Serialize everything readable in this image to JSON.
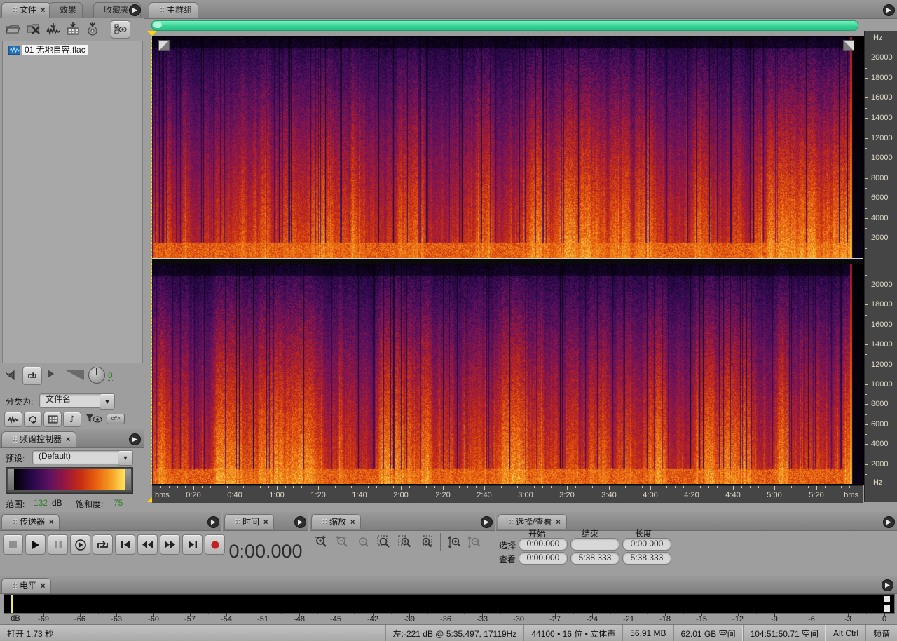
{
  "left_tabs": {
    "files": "文件",
    "effects": "效果",
    "favorites": "收藏夹"
  },
  "files_panel": {
    "file_item": {
      "name": "01 无地自容.flac"
    },
    "preview_volume": "0",
    "sort_label": "分类为:",
    "sort_value": "文件名"
  },
  "spectral_controls": {
    "title": "频谱控制器",
    "preset_label": "预设:",
    "preset_value": "(Default)",
    "range_label": "范围:",
    "range_value": "132",
    "range_unit": "dB",
    "saturation_label": "饱和度:",
    "saturation_value": "75"
  },
  "main_group": {
    "tab": "主群组"
  },
  "transport": {
    "title": "传送器"
  },
  "time_panel": {
    "title": "时间",
    "value": "0:00.000"
  },
  "zoom_panel": {
    "title": "缩放"
  },
  "sel_view": {
    "title": "选择/查看",
    "columns": [
      "开始",
      "结束",
      "长度"
    ],
    "row_labels": [
      "选择",
      "查看"
    ],
    "selection": [
      "0:00.000",
      "",
      "0:00.000"
    ],
    "view": [
      "0:00.000",
      "5:38.333",
      "5:38.333"
    ]
  },
  "levels": {
    "title": "电平",
    "unit_label": "dB",
    "db_ticks": [
      -69,
      -66,
      -63,
      -60,
      -57,
      -54,
      -51,
      -48,
      -45,
      -42,
      -39,
      -36,
      -33,
      -30,
      -27,
      -24,
      -21,
      -18,
      -15,
      -12,
      -9,
      -6,
      -3,
      0
    ]
  },
  "status_bar": {
    "open_time": "打开 1.73 秒",
    "cursor_info": "左:-221 dB @  5:35.497, 17119Hz",
    "format": "44100 • 16 位 • 立体声",
    "file_size": "56.91 MB",
    "disk_free": "62.01 GB 空间",
    "time_free": "104:51:50.71 空间",
    "keys": "Alt Ctrl",
    "view_mode": "频谱"
  },
  "icons": [
    "open-file-icon",
    "close-file-icon",
    "insert-multitrack-icon",
    "insert-video-icon",
    "insert-cd-icon",
    "options-icon",
    "autoplay-speaker-icon",
    "loop-preview-icon",
    "preview-play-icon",
    "volume-meter-icon",
    "volume-knob-icon",
    "filter-waveform-icon",
    "filter-loop-icon",
    "filter-video-icon",
    "filter-midi-icon",
    "filter-funnel-icon",
    "cda-icon",
    "stop-icon",
    "play-icon",
    "pause-icon",
    "play-from-cursor-icon",
    "loop-play-icon",
    "go-start-icon",
    "rewind-icon",
    "fast-forward-icon",
    "go-end-icon",
    "record-icon",
    "zoom-in-h-icon",
    "zoom-out-h-icon",
    "zoom-out-full-icon",
    "zoom-selection-icon",
    "zoom-sel-left-icon",
    "zoom-sel-right-icon",
    "zoom-in-v-icon",
    "zoom-out-v-icon",
    "panel-menu-icon",
    "dropdown-arrow-icon",
    "playhead-marker-icon",
    "fade-handle-icon"
  ],
  "chart_data": {
    "type": "heatmap",
    "subtype": "stereo-audio-spectrogram",
    "title": "01 无地自容.flac — spectral frequency display",
    "channels": 2,
    "x_axis": {
      "label": "hms",
      "start_s": 0,
      "end_s": 338.333,
      "audio_end_s": 333.5,
      "major_tick_s": 20,
      "minor_tick_s": 4,
      "tick_labels": [
        "0:20",
        "0:40",
        "1:00",
        "1:20",
        "1:40",
        "2:00",
        "2:20",
        "2:40",
        "3:00",
        "3:20",
        "3:40",
        "4:00",
        "4:20",
        "4:40",
        "5:00",
        "5:20"
      ]
    },
    "y_axis": {
      "label": "Hz",
      "min_hz": 0,
      "max_hz": 22050,
      "major_tick_hz": 2000,
      "tick_labels": [
        20000,
        18000,
        16000,
        14000,
        12000,
        10000,
        8000,
        6000,
        4000,
        2000
      ]
    },
    "palette": [
      [
        0,
        "#000000"
      ],
      [
        0.16,
        "#26084a"
      ],
      [
        0.32,
        "#5c1260"
      ],
      [
        0.47,
        "#9a1840"
      ],
      [
        0.6,
        "#c62c12"
      ],
      [
        0.74,
        "#e8600e"
      ],
      [
        0.87,
        "#f59c22"
      ],
      [
        1,
        "#ffe45c"
      ]
    ],
    "display_range_db": 132,
    "saturation": 75,
    "seed": 987654
  }
}
